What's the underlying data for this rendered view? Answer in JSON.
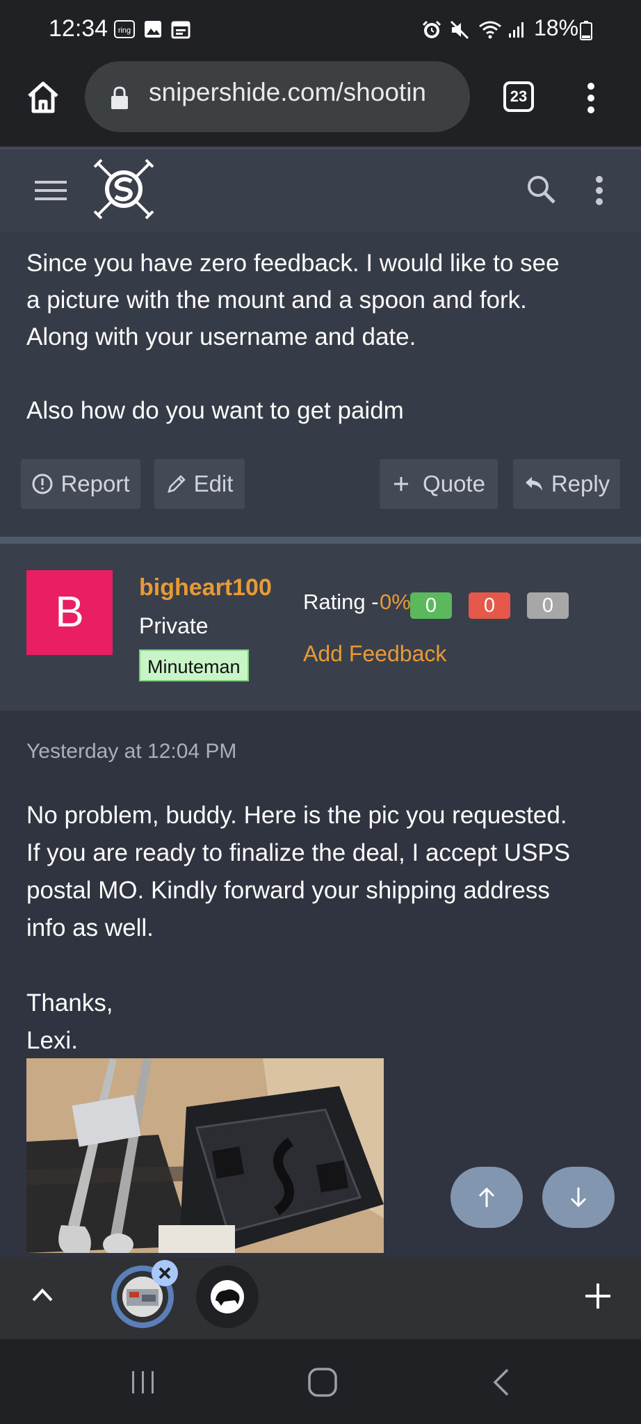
{
  "status_bar": {
    "time": "12:34",
    "battery": "18%",
    "icons": [
      "ring-icon",
      "image-icon",
      "calendar-icon",
      "alarm-icon",
      "mute-icon",
      "wifi-icon",
      "signal-icon",
      "battery-icon"
    ]
  },
  "browser": {
    "url": "snipershide.com/shootin",
    "tab_count": "23"
  },
  "post1": {
    "lines": [
      "Since you have zero feedback. I would like to see",
      "a picture with the mount and a spoon and fork.",
      "Along with your username and date.",
      "",
      "Also how do you want to get paidm"
    ],
    "actions": {
      "report": "Report",
      "edit": "Edit",
      "quote": "Quote",
      "reply": "Reply"
    }
  },
  "user": {
    "avatar_letter": "B",
    "avatar_color": "#e91e63",
    "username": "bigheart100",
    "title": "Private",
    "badge": "Minuteman",
    "rating_label": "Rating -",
    "rating_percent": "0%",
    "rating_counts": {
      "positive": "0",
      "negative": "0",
      "neutral": "0"
    },
    "add_feedback": "Add Feedback"
  },
  "post2": {
    "date": "Yesterday at 12:04 PM",
    "lines": [
      "No problem, buddy. Here is the pic you requested.",
      "If you are ready to finalize the deal, I accept USPS",
      "postal MO. Kindly forward your shipping address",
      "info as well.",
      "",
      "Thanks,",
      "Lexi."
    ]
  },
  "colors": {
    "accent_orange": "#e89a35",
    "positive": "#5cb85c",
    "negative": "#e5584a",
    "neutral": "#a7a7a7"
  }
}
